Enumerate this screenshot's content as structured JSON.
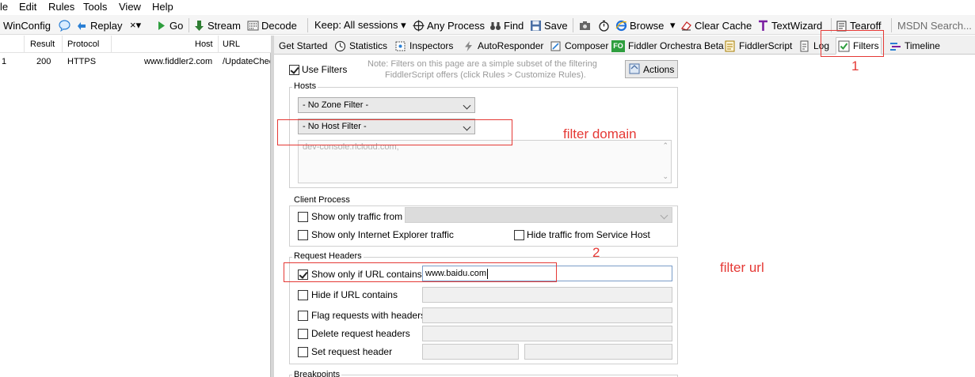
{
  "menu": [
    "le",
    "Edit",
    "Rules",
    "Tools",
    "View",
    "Help"
  ],
  "toolbar": {
    "winconfig": "WinConfig",
    "replay": "Replay",
    "remove": "×▾",
    "go": "Go",
    "stream": "Stream",
    "decode": "Decode",
    "keep": "Keep: All sessions ▾",
    "any_process": "Any Process",
    "find": "Find",
    "save": "Save",
    "browse": "Browse",
    "browse_arrow": "▾",
    "clear_cache": "Clear Cache",
    "textwizard": "TextWizard",
    "tearoff": "Tearoff",
    "search_placeholder": "MSDN Search..."
  },
  "sessions": {
    "columns": [
      "Result",
      "Protocol",
      "Host",
      "URL"
    ],
    "rows": [
      {
        "num": "1",
        "result": "200",
        "protocol": "HTTPS",
        "host": "www.fiddler2.com",
        "url": "/UpdateChec"
      }
    ]
  },
  "tabs": [
    "Get Started",
    "Statistics",
    "Inspectors",
    "AutoResponder",
    "Composer",
    "Fiddler Orchestra Beta",
    "FiddlerScript",
    "Log",
    "Filters",
    "Timeline"
  ],
  "filters": {
    "use_filters": "Use Filters",
    "note_line1": "Note: Filters on this page are a simple subset of the filtering",
    "note_line2": "FiddlerScript offers (click Rules > Customize Rules).",
    "actions": "Actions",
    "hosts": {
      "title": "Hosts",
      "zone_filter": "- No Zone Filter -",
      "host_filter": "- No Host Filter -",
      "host_list": "dev-console.rlcloud.com;"
    },
    "client_process": {
      "title": "Client Process",
      "show_only_from": "Show only traffic from",
      "show_only_ie": "Show only Internet Explorer traffic",
      "hide_service_host": "Hide traffic from Service Host"
    },
    "request_headers": {
      "title": "Request Headers",
      "show_if_url": "Show only if URL contains",
      "show_if_url_value": "www.baidu.com",
      "hide_if_url": "Hide if URL contains",
      "flag_requests": "Flag requests with headers",
      "delete_headers": "Delete request headers",
      "set_header": "Set request header"
    },
    "breakpoints": "Breakpoints"
  },
  "annotations": {
    "label_1": "1",
    "label_2": "2",
    "filter_domain": "filter domain",
    "filter_url": "filter url"
  },
  "colors": {
    "annotation": "#e53935",
    "accent_blue": "#1e6fd9",
    "check_green": "#2e9e3e"
  }
}
